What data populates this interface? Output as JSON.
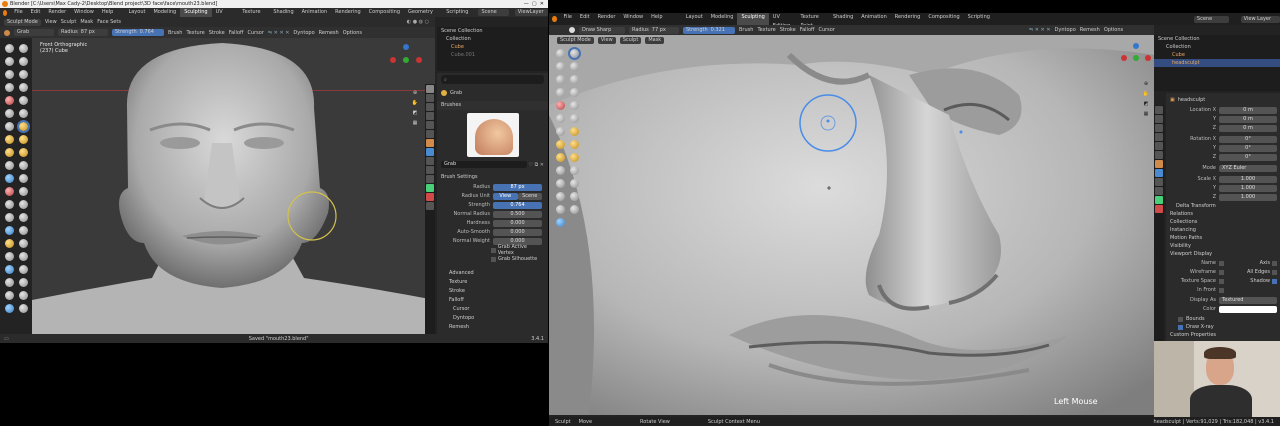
{
  "left": {
    "title": "Blender [C:\\Users\\Max Cady-2\\Desktop\\Blend project\\3D face\\face\\mouth23.blend]",
    "menu": [
      "File",
      "Edit",
      "Render",
      "Window",
      "Help"
    ],
    "workspaces": [
      "Layout",
      "Modeling",
      "Sculpting",
      "UV Editing",
      "Texture Paint",
      "Shading",
      "Animation",
      "Rendering",
      "Compositing",
      "Geometry Nodes",
      "Scripting"
    ],
    "active_workspace": "Sculpting",
    "scene": "Scene",
    "view_layer": "ViewLayer",
    "header": {
      "mode": "Sculpt Mode",
      "items": [
        "View",
        "Sculpt",
        "Mask",
        "Face Sets"
      ]
    },
    "tool_header": {
      "brush": "Grab",
      "radius_label": "Radius",
      "radius_value": "87 px",
      "strength_label": "Strength",
      "strength_value": "0.764",
      "items": [
        "Brush",
        "Texture",
        "Stroke",
        "Falloff",
        "Cursor"
      ],
      "dyntopo": "Dyntopo",
      "remesh": "Remesh",
      "options": "Options"
    },
    "viewport": {
      "view_name": "Front Orthographic",
      "object": "(237) Cube"
    },
    "outliner": {
      "root": "Scene Collection",
      "items": [
        "Collection",
        "Cube",
        "Cube.001"
      ]
    },
    "properties": {
      "brushes_title": "Brushes",
      "brush_name": "Grab",
      "brush_settings_title": "Brush Settings",
      "radius_label": "Radius",
      "radius_value": "87 px",
      "radius_unit_label": "Radius Unit",
      "view_opt": "View",
      "scene_opt": "Scene",
      "strength_label": "Strength",
      "strength_value": "0.764",
      "normal_radius_label": "Normal Radius",
      "normal_radius_value": "0.500",
      "hardness_label": "Hardness",
      "hardness_value": "0.000",
      "autosmooth_label": "Auto-Smooth",
      "autosmooth_value": "0.000",
      "normal_weight_label": "Normal Weight",
      "normal_weight_value": "0.000",
      "grab_active_vertex": "Grab Active Vertex",
      "grab_silhouette": "Grab Silhouette",
      "sections": [
        "Advanced",
        "Texture",
        "Stroke",
        "Falloff",
        "Cursor",
        "Dyntopo",
        "Remesh"
      ]
    },
    "status": {
      "saved": "Saved \"mouth23.blend\"",
      "version": "3.4.1"
    }
  },
  "right": {
    "menu": [
      "File",
      "Edit",
      "Render",
      "Window",
      "Help"
    ],
    "workspaces": [
      "Layout",
      "Modeling",
      "Sculpting",
      "UV Editing",
      "Texture Paint",
      "Shading",
      "Animation",
      "Rendering",
      "Compositing",
      "Scripting"
    ],
    "active_workspace": "Sculpting",
    "scene": "Scene",
    "view_layer": "View Layer",
    "tool_header": {
      "brush": "Draw Sharp",
      "radius_label": "Radius",
      "radius_value": "77 px",
      "strength_label": "Strength",
      "strength_value": "0.321",
      "items": [
        "Brush",
        "Texture",
        "Stroke",
        "Falloff",
        "Cursor"
      ],
      "dyntopo": "Dyntopo",
      "remesh": "Remesh",
      "options": "Options"
    },
    "header": {
      "mode": "Sculpt Mode",
      "items": [
        "View",
        "Sculpt",
        "Mask"
      ]
    },
    "overlay_text": "Left Mouse",
    "outliner": {
      "root": "Scene Collection",
      "items": [
        "Collection",
        "Cube",
        "headsculpt"
      ]
    },
    "properties": {
      "object_name": "headsculpt",
      "location_label": "Location X",
      "loc_y": "Y",
      "loc_z": "Z",
      "loc_value": "0 m",
      "rotation_label": "Rotation X",
      "rot_value": "0°",
      "mode_label": "Mode",
      "mode_value": "XYZ Euler",
      "scale_label": "Scale X",
      "scale_value": "1.000",
      "sections": [
        "Delta Transform",
        "Relations",
        "Collections",
        "Instancing",
        "Motion Paths",
        "Visibility",
        "Viewport Display"
      ],
      "name_label": "Name",
      "axis_label": "Axis",
      "wireframe_label": "Wireframe",
      "all_edges_label": "All Edges",
      "texture_space_label": "Texture Space",
      "shadow_label": "Shadow",
      "in_front_label": "In Front",
      "display_as_label": "Display As",
      "display_as_value": "Textured",
      "color_label": "Color",
      "bounds_label": "Bounds",
      "draw_xray_label": "Draw X-ray",
      "custom_props_label": "Custom Properties"
    },
    "status": {
      "left": "Sculpt",
      "move": "Move",
      "rotate": "Rotate View",
      "context": "Sculpt Context Menu",
      "stats": "headsculpt | Verts:91,029 | Tris:182,048 | v3.4.1"
    }
  }
}
